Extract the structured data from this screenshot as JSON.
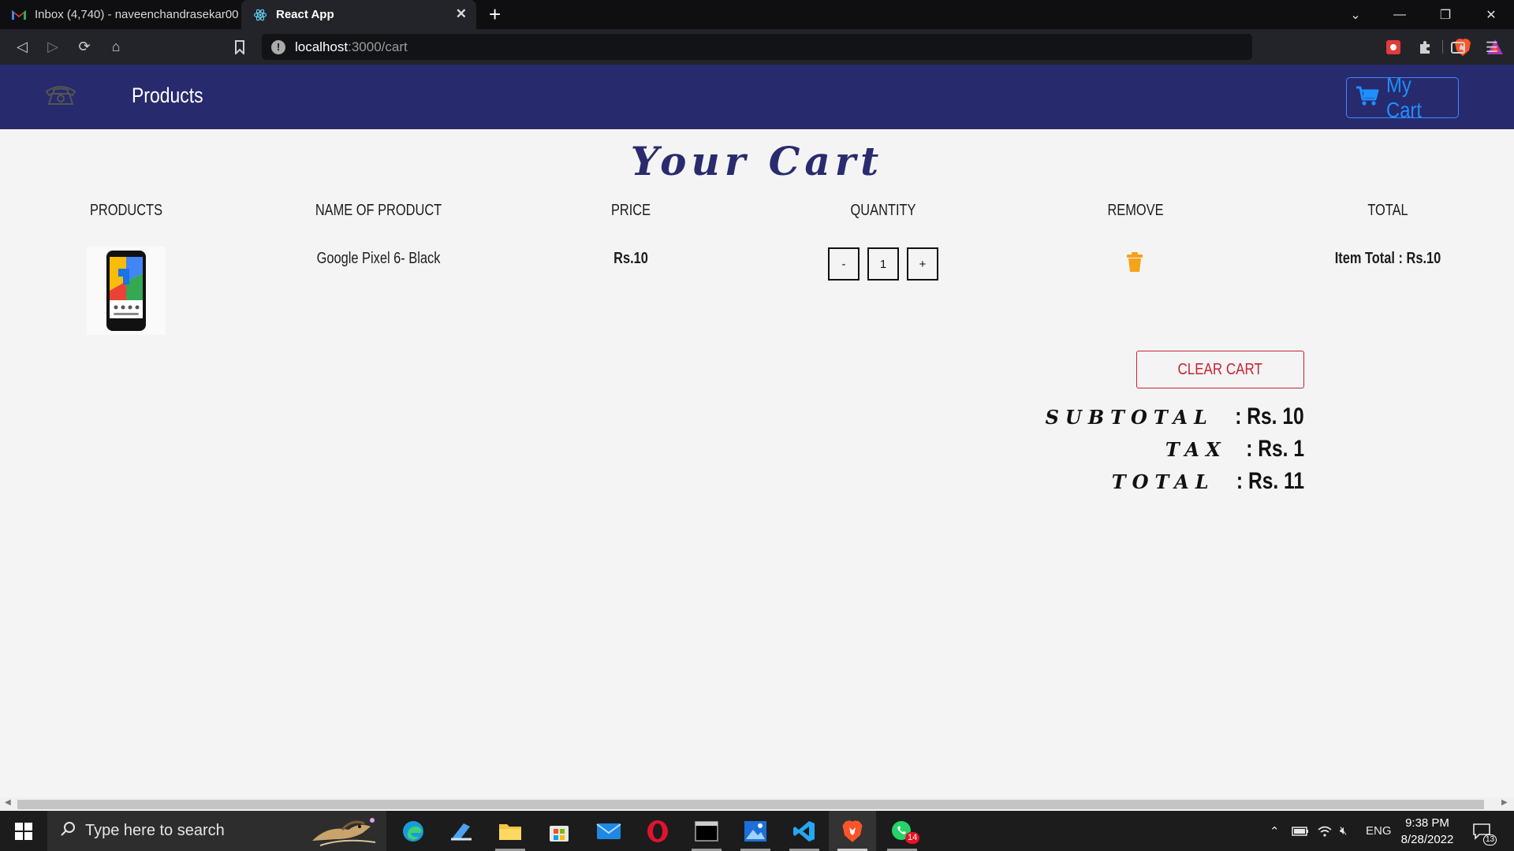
{
  "browser": {
    "tabs": [
      {
        "title": "Inbox (4,740) - naveenchandrasekar00",
        "active": false
      },
      {
        "title": "React App",
        "active": true
      }
    ],
    "url_host": "localhost",
    "url_path": ":3000/cart"
  },
  "header": {
    "nav_products": "Products",
    "cart_button": "My Cart"
  },
  "page": {
    "title": "Your Cart",
    "columns": [
      "PRODUCTS",
      "NAME OF PRODUCT",
      "PRICE",
      "QUANTITY",
      "REMOVE",
      "TOTAL"
    ],
    "items": [
      {
        "name": "Google Pixel 6- Black",
        "price": "Rs.10",
        "quantity": "1",
        "decrement": "-",
        "increment": "+",
        "item_total": "Item Total : Rs.10"
      }
    ],
    "clear_cart": "CLEAR CART",
    "summary": {
      "subtotal_label": "Subtotal",
      "subtotal_value": ": Rs. 10",
      "tax_label": "Tax",
      "tax_value": ": Rs. 1",
      "total_label": "Total",
      "total_value": ": Rs. 11"
    }
  },
  "taskbar": {
    "search_placeholder": "Type here to search",
    "whatsapp_badge": "14",
    "language": "ENG",
    "time": "9:38 PM",
    "date": "8/28/2022",
    "notifications": "13"
  },
  "colors": {
    "header_bg": "#272a6c",
    "cart_accent": "#1e8fff",
    "clear_red": "#c82333",
    "trash_orange": "#f7a21b"
  }
}
